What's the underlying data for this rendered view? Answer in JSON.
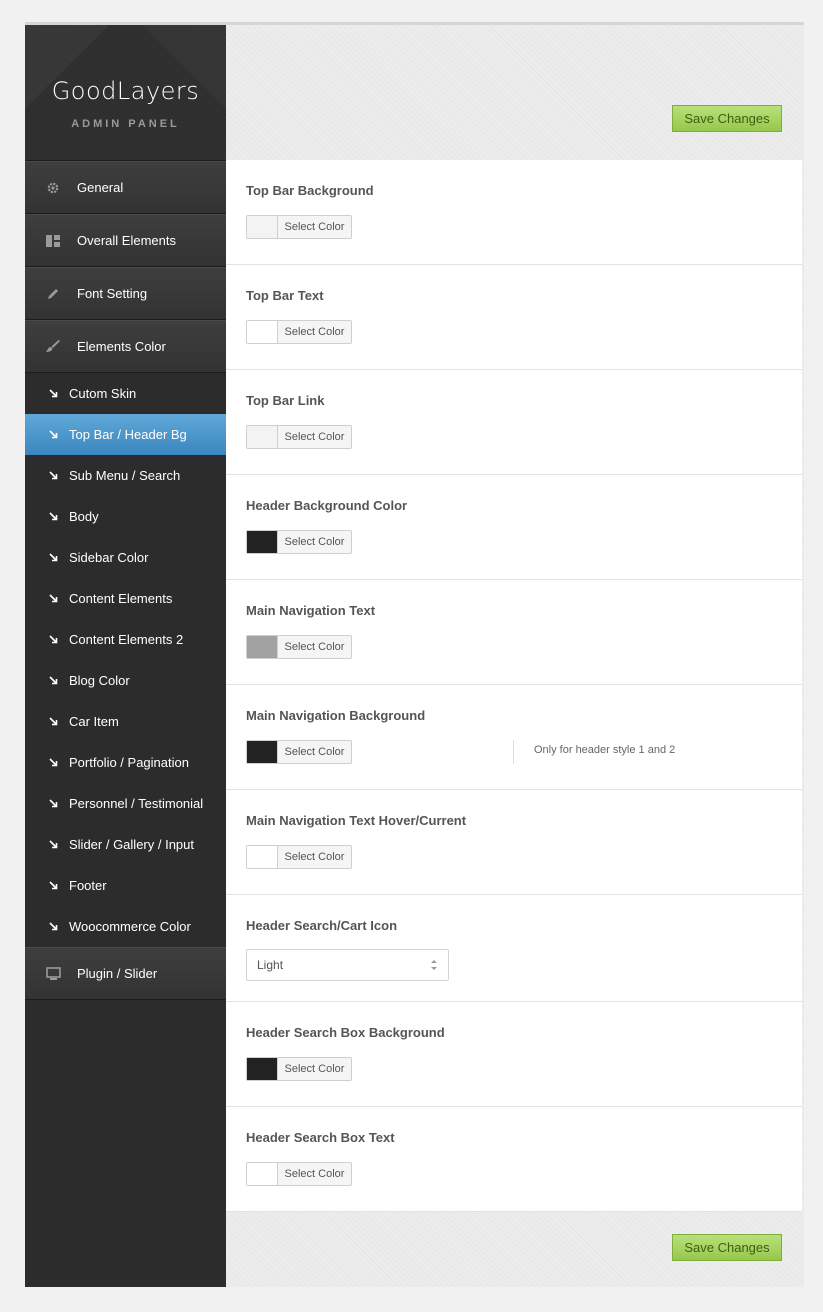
{
  "brand": {
    "title": "GoodLayers",
    "subtitle": "ADMIN PANEL"
  },
  "toolbar": {
    "save_label": "Save Changes"
  },
  "sidebar": {
    "items": [
      {
        "label": "General",
        "icon": "gear-icon"
      },
      {
        "label": "Overall Elements",
        "icon": "layout-icon"
      },
      {
        "label": "Font Setting",
        "icon": "pencil-icon"
      },
      {
        "label": "Elements Color",
        "icon": "brush-icon"
      }
    ],
    "sub_items": [
      "Cutom Skin",
      "Top Bar / Header Bg",
      "Sub Menu / Search",
      "Body",
      "Sidebar Color",
      "Content Elements",
      "Content Elements 2",
      "Blog Color",
      "Car Item",
      "Portfolio / Pagination",
      "Personnel / Testimonial",
      "Slider / Gallery / Input",
      "Footer",
      "Woocommerce Color"
    ],
    "active_sub": "Top Bar / Header Bg",
    "bottom_item": {
      "label": "Plugin / Slider",
      "icon": "monitor-icon"
    }
  },
  "settings": {
    "picker_label": "Select Color",
    "rows": [
      {
        "label": "Top Bar Background",
        "color": "#f3f3f3"
      },
      {
        "label": "Top Bar Text",
        "color": "#ffffff"
      },
      {
        "label": "Top Bar Link",
        "color": "#f3f3f3"
      },
      {
        "label": "Header Background Color",
        "color": "#222222"
      },
      {
        "label": "Main Navigation Text",
        "color": "#a2a2a2"
      },
      {
        "label": "Main Navigation Background",
        "color": "#222222",
        "note": "Only for header style 1 and 2"
      },
      {
        "label": "Main Navigation Text Hover/Current",
        "color": "#ffffff"
      },
      {
        "label": "Header Search/Cart Icon",
        "select_value": "Light"
      },
      {
        "label": "Header Search Box Background",
        "color": "#222222"
      },
      {
        "label": "Header Search Box Text",
        "color": "#ffffff"
      }
    ]
  },
  "colors": {
    "sidebar_bg": "#2c2c2c",
    "active_item": "#4a97cc",
    "save_button": "#a8d563"
  }
}
